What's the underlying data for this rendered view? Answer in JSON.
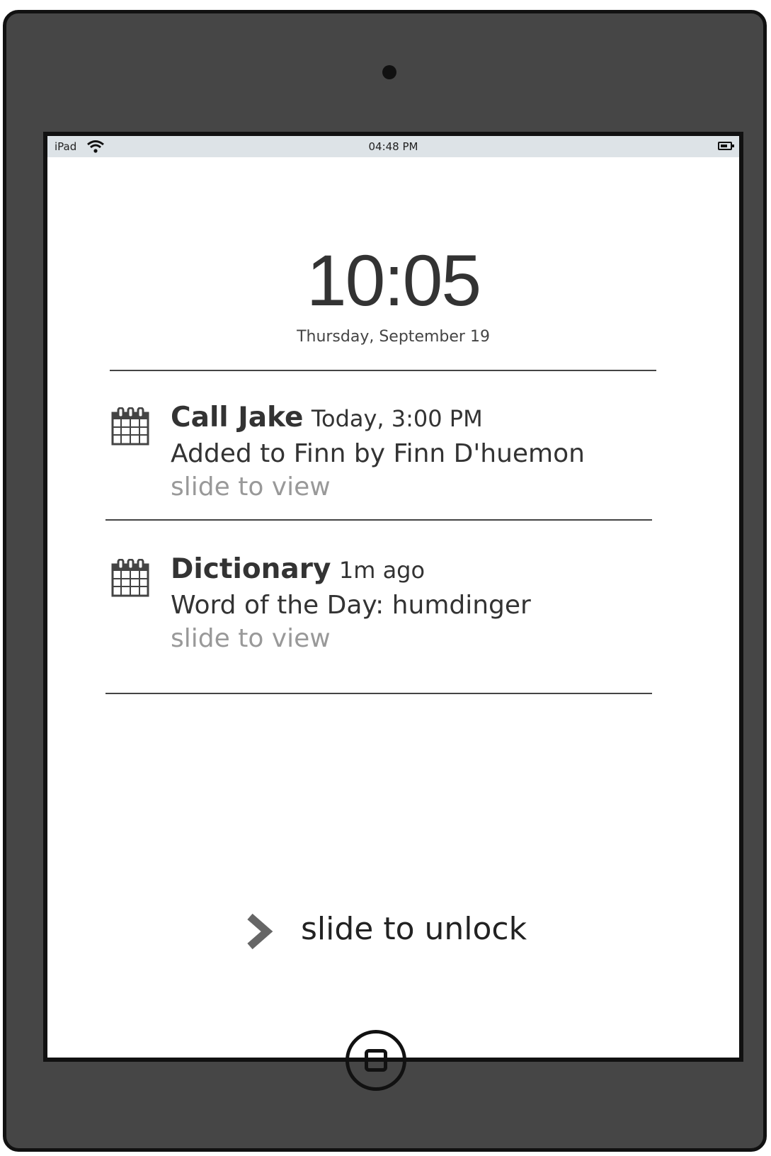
{
  "status_bar": {
    "device": "iPad",
    "time": "04:48 PM",
    "wifi_icon": "wifi-icon",
    "battery_icon": "battery-icon"
  },
  "lock_screen": {
    "clock": "10:05",
    "date": "Thursday, September 19"
  },
  "notifications": [
    {
      "icon": "calendar-icon",
      "title": "Call Jake",
      "time": "Today, 3:00 PM",
      "body": "Added to Finn by Finn D'huemon",
      "action": "slide to view"
    },
    {
      "icon": "calendar-icon",
      "title": "Dictionary",
      "time": "1m ago",
      "body": "Word of the Day: humdinger",
      "action": "slide to view"
    }
  ],
  "unlock": {
    "label": "slide to unlock",
    "icon": "chevron-right-icon"
  },
  "colors": {
    "device_body": "#464646",
    "status_bar": "#dde3e7",
    "muted_text": "#999999",
    "chevron": "#666666"
  }
}
